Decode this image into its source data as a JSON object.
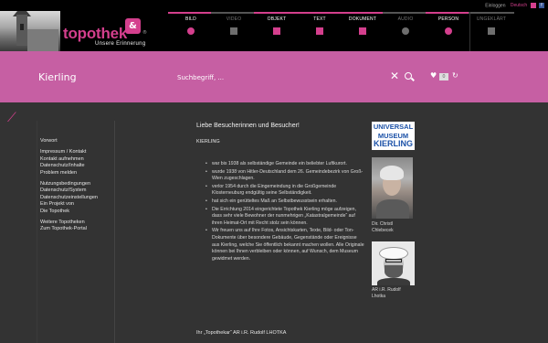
{
  "header": {
    "logo_text": "topothek",
    "logo_subtitle": "Unsere Erinnerung",
    "top_links": {
      "login": "Einloggen",
      "language": "Deutsch"
    },
    "nav": [
      {
        "label": "BILD",
        "icon": "image-icon",
        "enabled": true
      },
      {
        "label": "VIDEO",
        "icon": "film-icon",
        "enabled": false
      },
      {
        "label": "OBJEKT",
        "icon": "object-icon",
        "enabled": true
      },
      {
        "label": "TEXT",
        "icon": "text-icon",
        "enabled": true
      },
      {
        "label": "DOKUMENT",
        "icon": "document-icon",
        "enabled": true
      },
      {
        "label": "AUDIO",
        "icon": "audio-icon",
        "enabled": false
      },
      {
        "label": "PERSON",
        "icon": "person-icon",
        "enabled": true
      },
      {
        "label": "UNGEKLÄRT",
        "icon": "question-icon",
        "enabled": false
      }
    ]
  },
  "searchbar": {
    "place": "Kierling",
    "placeholder": "Suchbegriff, ...",
    "favorites_count": "0"
  },
  "sidebar": {
    "groups": [
      [
        "Vorwort"
      ],
      [
        "Impressum / Kontakt",
        "Kontakt aufnehmen",
        "Datenschutz/Inhalte",
        "Problem melden"
      ],
      [
        "Nutzungsbedingungen",
        "Datenschutz/System",
        "Datenschutzeinstellungen",
        "Ein Projekt von",
        "Die Topothek"
      ],
      [
        "Weitere Topotheken",
        "Zum Topothek-Portal"
      ]
    ]
  },
  "content": {
    "heading": "Liebe Besucherinnen und Besucher!",
    "subheading": "KIERLING",
    "bullets": [
      "war bis 1938 als selbständige Gemeinde ein beliebter Luftkurort.",
      "wurde 1938 von Hitler-Deutschland dem 26. Gemeindebezirk von Groß-Wien zugeschlagen.",
      "verlor 1954 durch die Eingemeindung in die Großgemeinde Klosterneuburg endgültig seine Selbständigkeit.",
      "hat sich ein gerütteltes Maß an Selbstbewusstsein erhalten.",
      "Die Errichtung 2014 eingerichtete Topothek Kierling möge aufzeigen, dass sehr viele Bewohner der nunmehrigen „Katastralgemeinde“ auf ihren Heimat-Ort mit Recht stolz sein können.",
      "Wir freuen uns auf Ihre Fotos, Ansichtskarten, Texte, Bild- oder Ton-Dokumente über besondere Gebäude, Gegenstände oder Ereignisse aus Kierling, welche Sie öffentlich bekannt machen wollen. Alle Originale können bei Ihnen verbleiben oder können, auf Wunsch, dem Museum gewidmet werden."
    ],
    "signoff": "Ihr „Topothekar“ AR i.R. Rudolf LHOTKA"
  },
  "right_column": {
    "museum_logo": [
      "UNIVERSAL",
      "MUSEUM",
      "KIERLING"
    ],
    "photos": [
      {
        "caption": [
          "Dir. Christl",
          "Chlebecek"
        ]
      },
      {
        "caption": [
          "AR i.R. Rudolf",
          "Lhotka"
        ]
      }
    ]
  }
}
